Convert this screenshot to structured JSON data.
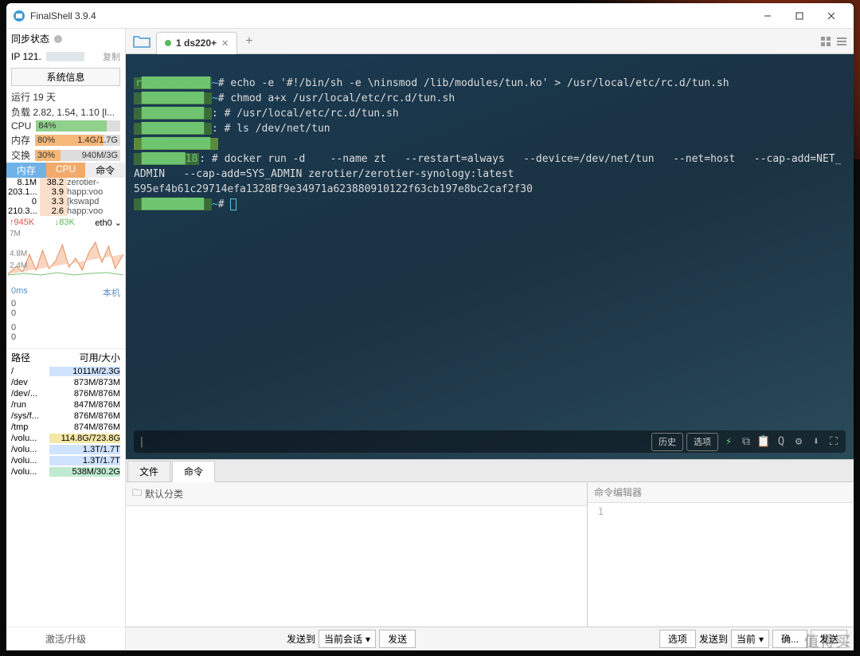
{
  "window": {
    "title": "FinalShell 3.9.4"
  },
  "sidebar": {
    "sync_label": "同步状态",
    "ip_prefix": "IP 121.",
    "copy_label": "复制",
    "sysinfo_btn": "系统信息",
    "uptime_label": "运行 19 天",
    "load_label": "负载 2.82, 1.54, 1.10 [l...",
    "cpu_label": "CPU",
    "cpu_pct": "84%",
    "mem_label": "内存",
    "mem_pct": "80%",
    "mem_val": "1.4G/1.7G",
    "swap_label": "交换",
    "swap_pct": "30%",
    "swap_val": "940M/3G",
    "proc_tabs": {
      "mem": "内存",
      "cpu": "CPU",
      "cmd": "命令"
    },
    "procs": [
      {
        "mem": "8.1M",
        "cpu": "38.2",
        "cmd": "zerotier-"
      },
      {
        "mem": "203.1...",
        "cpu": "3.9",
        "cmd": "happ:voo"
      },
      {
        "mem": "0",
        "cpu": "3.3",
        "cmd": "[kswapd"
      },
      {
        "mem": "210.3...",
        "cpu": "2.6",
        "cmd": "happ:voo"
      }
    ],
    "net": {
      "up": "↑945K",
      "down": "↓83K",
      "iface": "eth0 ⌄"
    },
    "chart_labels": [
      "7M",
      "4.8M",
      "2.4M"
    ],
    "latency": {
      "ms": "0ms",
      "host": "本机",
      "vals": [
        "0",
        "0",
        "0",
        "0"
      ]
    },
    "disk_hdr": {
      "path": "路径",
      "avail": "可用/大小"
    },
    "disks": [
      {
        "path": "/",
        "avail": "1011M/2.3G",
        "cls": "diskbar-blue"
      },
      {
        "path": "/dev",
        "avail": "873M/873M",
        "cls": ""
      },
      {
        "path": "/dev/...",
        "avail": "876M/876M",
        "cls": ""
      },
      {
        "path": "/run",
        "avail": "847M/876M",
        "cls": ""
      },
      {
        "path": "/sys/f...",
        "avail": "876M/876M",
        "cls": ""
      },
      {
        "path": "/tmp",
        "avail": "874M/876M",
        "cls": ""
      },
      {
        "path": "/volu...",
        "avail": "114.8G/723.8G",
        "cls": "diskbar-yellow"
      },
      {
        "path": "/volu...",
        "avail": "1.3T/1.7T",
        "cls": "diskbar-blue"
      },
      {
        "path": "/volu...",
        "avail": "1.3T/1.7T",
        "cls": "diskbar-blue"
      },
      {
        "path": "/volu...",
        "avail": "538M/30.2G",
        "cls": "diskbar-teal"
      }
    ],
    "activate": "激活/升级"
  },
  "tabs": {
    "active": "1 ds220+"
  },
  "terminal": {
    "l1_cmd": "# echo -e '#!/bin/sh -e \\ninsmod /lib/modules/tun.ko' > /usr/local/etc/rc.d/tun.sh",
    "l2_cmd": "# chmod a+x /usr/local/etc/rc.d/tun.sh",
    "l3_cmd": ": # /usr/local/etc/rc.d/tun.sh",
    "l4_cmd": ": # ls /dev/net/tun",
    "l5_out": "",
    "l6_cmd": ": # docker run -d    --name zt   --restart=always   --device=/dev/net/tun   --net=host   --cap-add=NET_ADMIN   --cap-add=SYS_ADMIN zerotier/zerotier-synology:latest",
    "l7_out": "595ef4b61c29714efa1328Bf9e34971a623880910122f63cb197e8bc2caf2f30",
    "l8_cmd": "#"
  },
  "cmdbar": {
    "hist": "历史",
    "opt": "选项"
  },
  "bottom_tabs": {
    "files": "文件",
    "cmd": "命令"
  },
  "commands": {
    "default_cat": "默认分类",
    "editor_title": "命令编辑器",
    "lineno": "1"
  },
  "footer": {
    "send_to": "发送到",
    "cur_session": "当前会话",
    "send": "发送",
    "options": "选项",
    "send_to2": "发送到",
    "current": "当前",
    "confirm": "确...",
    "send2": "发送"
  },
  "watermark": "值得买"
}
